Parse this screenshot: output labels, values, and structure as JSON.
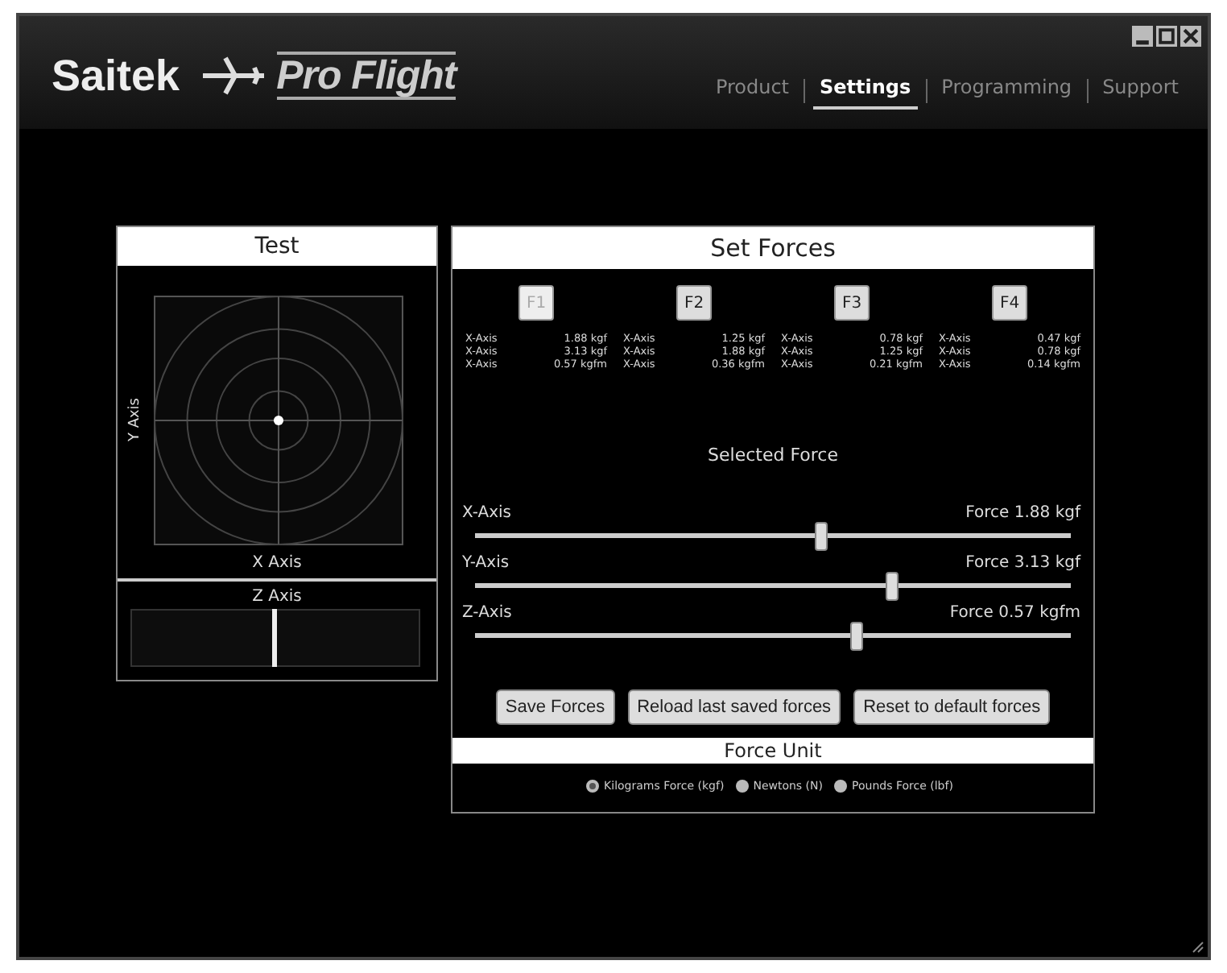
{
  "brand": {
    "name": "Saitek",
    "product": "Pro Flight"
  },
  "nav": [
    {
      "label": "Product",
      "selected": false
    },
    {
      "label": "Settings",
      "selected": true
    },
    {
      "label": "Programming",
      "selected": false
    },
    {
      "label": "Support",
      "selected": false
    }
  ],
  "test_panel": {
    "title": "Test",
    "y_label": "Y Axis",
    "x_label": "X Axis",
    "z_label": "Z Axis"
  },
  "forces_panel": {
    "title": "Set Forces",
    "presets": [
      {
        "label": "F1",
        "selected": true,
        "rows": [
          [
            "X-Axis",
            "1.88 kgf"
          ],
          [
            "X-Axis",
            "3.13 kgf"
          ],
          [
            "X-Axis",
            "0.57 kgfm"
          ]
        ]
      },
      {
        "label": "F2",
        "selected": false,
        "rows": [
          [
            "X-Axis",
            "1.25 kgf"
          ],
          [
            "X-Axis",
            "1.88 kgf"
          ],
          [
            "X-Axis",
            "0.36 kgfm"
          ]
        ]
      },
      {
        "label": "F3",
        "selected": false,
        "rows": [
          [
            "X-Axis",
            "0.78 kgf"
          ],
          [
            "X-Axis",
            "1.25 kgf"
          ],
          [
            "X-Axis",
            "0.21 kgfm"
          ]
        ]
      },
      {
        "label": "F4",
        "selected": false,
        "rows": [
          [
            "X-Axis",
            "0.47 kgf"
          ],
          [
            "X-Axis",
            "0.78 kgf"
          ],
          [
            "X-Axis",
            "0.14 kgfm"
          ]
        ]
      }
    ],
    "selected_title": "Selected Force",
    "sliders": [
      {
        "name": "X-Axis",
        "reading": "Force 1.88 kgf",
        "level": 0.58
      },
      {
        "name": "Y-Axis",
        "reading": "Force 3.13 kgf",
        "level": 0.7
      },
      {
        "name": "Z-Axis",
        "reading": "Force 0.57 kgfm",
        "level": 0.64
      }
    ],
    "buttons": [
      "Save Forces",
      "Reload last saved forces",
      "Reset to default forces"
    ],
    "unit_title": "Force Unit",
    "units": [
      {
        "label": "Kilograms Force (kgf)",
        "selected": true
      },
      {
        "label": "Newtons (N)",
        "selected": false
      },
      {
        "label": "Pounds Force (lbf)",
        "selected": false
      }
    ]
  }
}
